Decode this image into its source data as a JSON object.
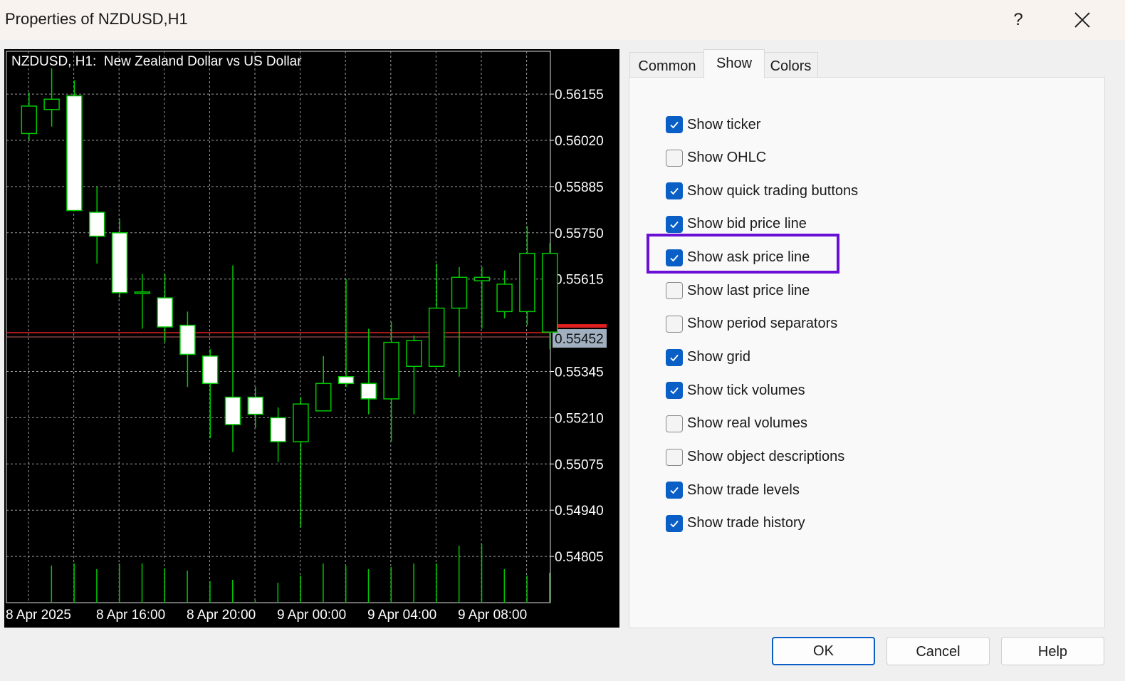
{
  "window": {
    "title": "Properties of NZDUSD,H1",
    "help_label": "?"
  },
  "chart": {
    "header": "NZDUSD, H1:  New Zealand Dollar vs US Dollar",
    "price_labels": [
      "0.56155",
      "0.56020",
      "0.55885",
      "0.55750",
      "0.55615",
      "0.55345",
      "0.55210",
      "0.55075",
      "0.54940",
      "0.54805"
    ],
    "current_price": "0.55452",
    "time_labels": [
      "8 Apr 2025",
      "8 Apr 16:00",
      "8 Apr 20:00",
      "9 Apr 00:00",
      "9 Apr 04:00",
      "9 Apr 08:00"
    ],
    "colors": {
      "background": "#000000",
      "bull_body": "#ffffff",
      "wick": "#00c800",
      "grid": "#9a9a9a",
      "bid_line": "#e02020",
      "price_tag": "#a0b0c0"
    }
  },
  "chart_data": {
    "type": "candlestick",
    "title": "NZDUSD, H1:  New Zealand Dollar vs US Dollar",
    "ylim": [
      0.5467,
      0.5628
    ],
    "current_price": 0.55452,
    "candles": [
      {
        "o": 0.5604,
        "h": 0.5616,
        "l": 0.5602,
        "c": 0.5612
      },
      {
        "o": 0.5611,
        "h": 0.5623,
        "l": 0.5606,
        "c": 0.5614
      },
      {
        "o": 0.5615,
        "h": 0.56195,
        "l": 0.55815,
        "c": 0.55815
      },
      {
        "o": 0.5581,
        "h": 0.55885,
        "l": 0.5566,
        "c": 0.5574
      },
      {
        "o": 0.5575,
        "h": 0.5579,
        "l": 0.5556,
        "c": 0.55575
      },
      {
        "o": 0.55575,
        "h": 0.5563,
        "l": 0.5547,
        "c": 0.55575
      },
      {
        "o": 0.5556,
        "h": 0.5563,
        "l": 0.5543,
        "c": 0.55475
      },
      {
        "o": 0.5548,
        "h": 0.5552,
        "l": 0.553,
        "c": 0.55395
      },
      {
        "o": 0.5539,
        "h": 0.5541,
        "l": 0.5515,
        "c": 0.5531
      },
      {
        "o": 0.5527,
        "h": 0.55655,
        "l": 0.5511,
        "c": 0.5519
      },
      {
        "o": 0.5527,
        "h": 0.553,
        "l": 0.5518,
        "c": 0.5522
      },
      {
        "o": 0.5521,
        "h": 0.5524,
        "l": 0.5508,
        "c": 0.5514
      },
      {
        "o": 0.5514,
        "h": 0.5527,
        "l": 0.5489,
        "c": 0.5525
      },
      {
        "o": 0.5523,
        "h": 0.5539,
        "l": 0.5523,
        "c": 0.5531
      },
      {
        "o": 0.5533,
        "h": 0.55615,
        "l": 0.553,
        "c": 0.5531
      },
      {
        "o": 0.5531,
        "h": 0.5547,
        "l": 0.5522,
        "c": 0.55265
      },
      {
        "o": 0.55265,
        "h": 0.5549,
        "l": 0.5514,
        "c": 0.5543
      },
      {
        "o": 0.5536,
        "h": 0.5545,
        "l": 0.5522,
        "c": 0.55435
      },
      {
        "o": 0.5536,
        "h": 0.5566,
        "l": 0.5536,
        "c": 0.5553
      },
      {
        "o": 0.5553,
        "h": 0.5565,
        "l": 0.5533,
        "c": 0.5562
      },
      {
        "o": 0.5561,
        "h": 0.5565,
        "l": 0.5547,
        "c": 0.5562
      },
      {
        "o": 0.5552,
        "h": 0.5564,
        "l": 0.555,
        "c": 0.556
      },
      {
        "o": 0.5552,
        "h": 0.5577,
        "l": 0.5548,
        "c": 0.5569
      },
      {
        "o": 0.5546,
        "h": 0.5572,
        "l": 0.5541,
        "c": 0.5569
      }
    ],
    "volumes": [
      0,
      52,
      55,
      47,
      55,
      55,
      48,
      45,
      30,
      32,
      3,
      28,
      38,
      55,
      52,
      47,
      50,
      55,
      55,
      80,
      82,
      47,
      38,
      42,
      40
    ]
  },
  "tabs": [
    {
      "label": "Common",
      "active": false
    },
    {
      "label": "Show",
      "active": true
    },
    {
      "label": "Colors",
      "active": false
    }
  ],
  "options": [
    {
      "label": "Show ticker",
      "checked": true
    },
    {
      "label": "Show OHLC",
      "checked": false
    },
    {
      "label": "Show quick trading buttons",
      "checked": true
    },
    {
      "label": "Show bid price line",
      "checked": true
    },
    {
      "label": "Show ask price line",
      "checked": true
    },
    {
      "label": "Show last price line",
      "checked": false
    },
    {
      "label": "Show period separators",
      "checked": false
    },
    {
      "label": "Show grid",
      "checked": true
    },
    {
      "label": "Show tick volumes",
      "checked": true
    },
    {
      "label": "Show real volumes",
      "checked": false
    },
    {
      "label": "Show object descriptions",
      "checked": false
    },
    {
      "label": "Show trade levels",
      "checked": true
    },
    {
      "label": "Show trade history",
      "checked": true
    }
  ],
  "buttons": {
    "ok": "OK",
    "cancel": "Cancel",
    "help": "Help"
  },
  "colors": {
    "accent": "#0a5fc6",
    "highlight": "#6a0fd6"
  }
}
